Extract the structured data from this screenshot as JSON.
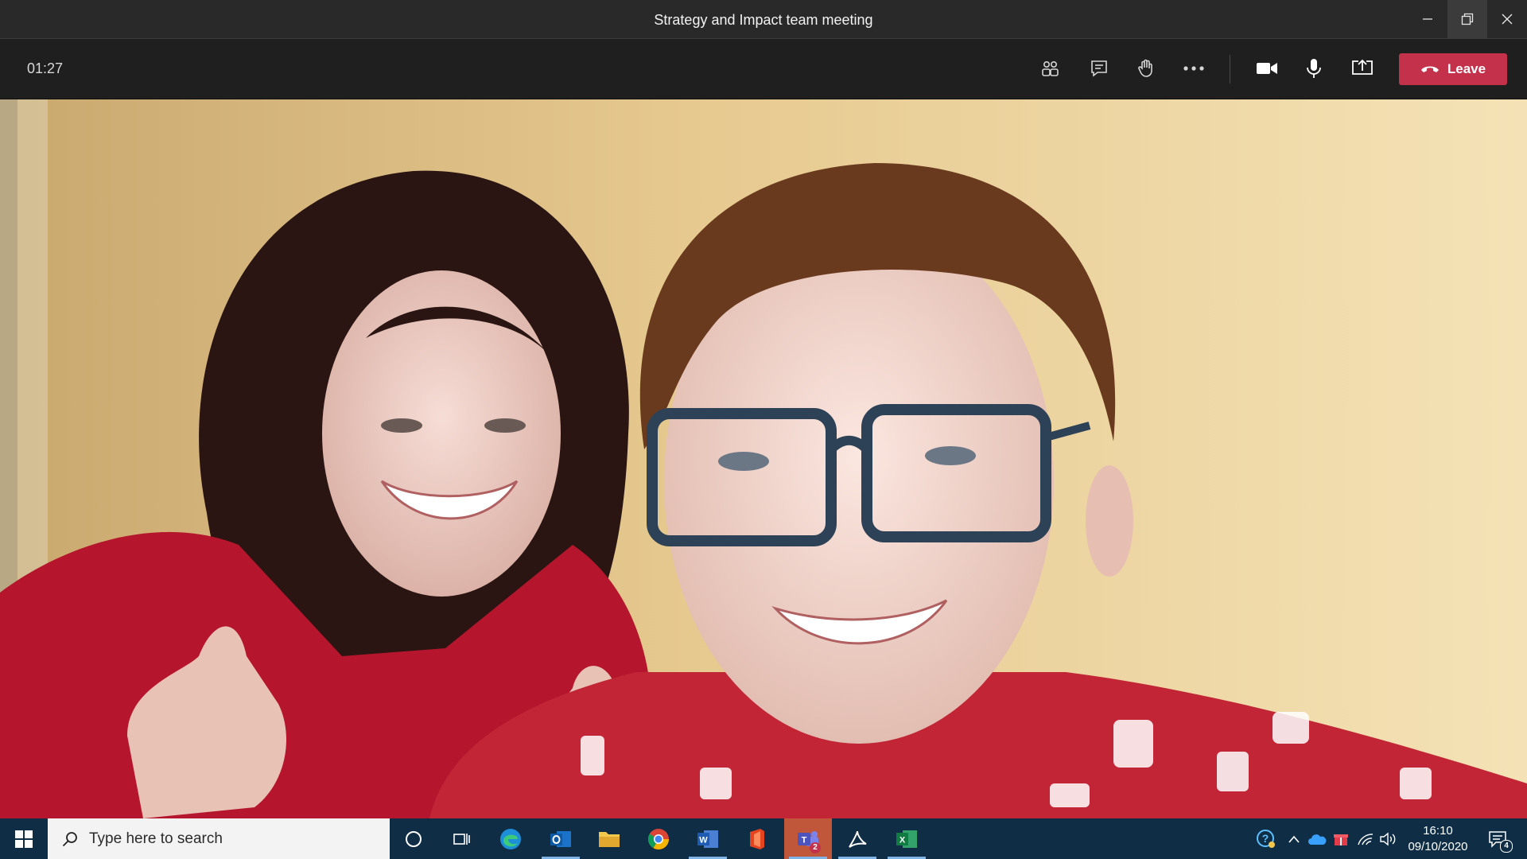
{
  "window": {
    "title": "Strategy and Impact team meeting"
  },
  "toolbar": {
    "timer": "01:27",
    "leave_label": "Leave",
    "buttons": [
      "participants-icon",
      "chat-icon",
      "raise-hand-icon",
      "more-options-icon",
      "camera-icon",
      "microphone-icon",
      "share-screen-icon"
    ]
  },
  "taskbar": {
    "search_placeholder": "Type here to search",
    "apps": [
      "cortana",
      "task-view",
      "edge",
      "outlook",
      "file-explorer",
      "chrome",
      "word",
      "office",
      "teams",
      "acrobat",
      "excel"
    ],
    "teams_badge": "2",
    "clock_time": "16:10",
    "clock_date": "09/10/2020",
    "notifications_badge": "4"
  },
  "colors": {
    "leave_button": "#c4314b",
    "taskbar": "#0f2e46",
    "active_app": "#c0573a"
  }
}
